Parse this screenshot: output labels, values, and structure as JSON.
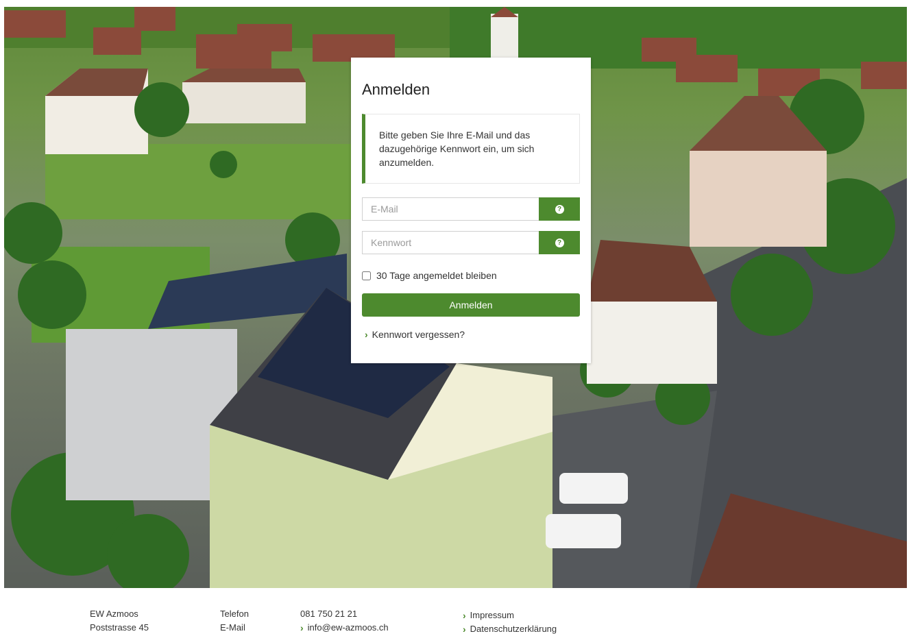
{
  "login": {
    "title": "Anmelden",
    "notice": "Bitte geben Sie Ihre E-Mail und das dazugehörige Kennwort ein, um sich anzumelden.",
    "email_placeholder": "E-Mail",
    "password_placeholder": "Kennwort",
    "help_glyph": "?",
    "remember_label": "30 Tage angemeldet bleiben",
    "submit_label": "Anmelden",
    "forgot_label": "Kennwort vergessen?"
  },
  "footer": {
    "company": "EW Azmoos",
    "street": "Poststrasse 45",
    "phone_label": "Telefon",
    "email_label": "E-Mail",
    "phone": "081 750 21 21",
    "email": "info@ew-azmoos.ch",
    "links": [
      "Impressum",
      "Datenschutzerklärung"
    ]
  },
  "icons": {
    "help": "question-circle-icon",
    "chevron": "chevron-right-icon"
  },
  "colors": {
    "accent": "#4d8a2e",
    "text": "#333333"
  }
}
